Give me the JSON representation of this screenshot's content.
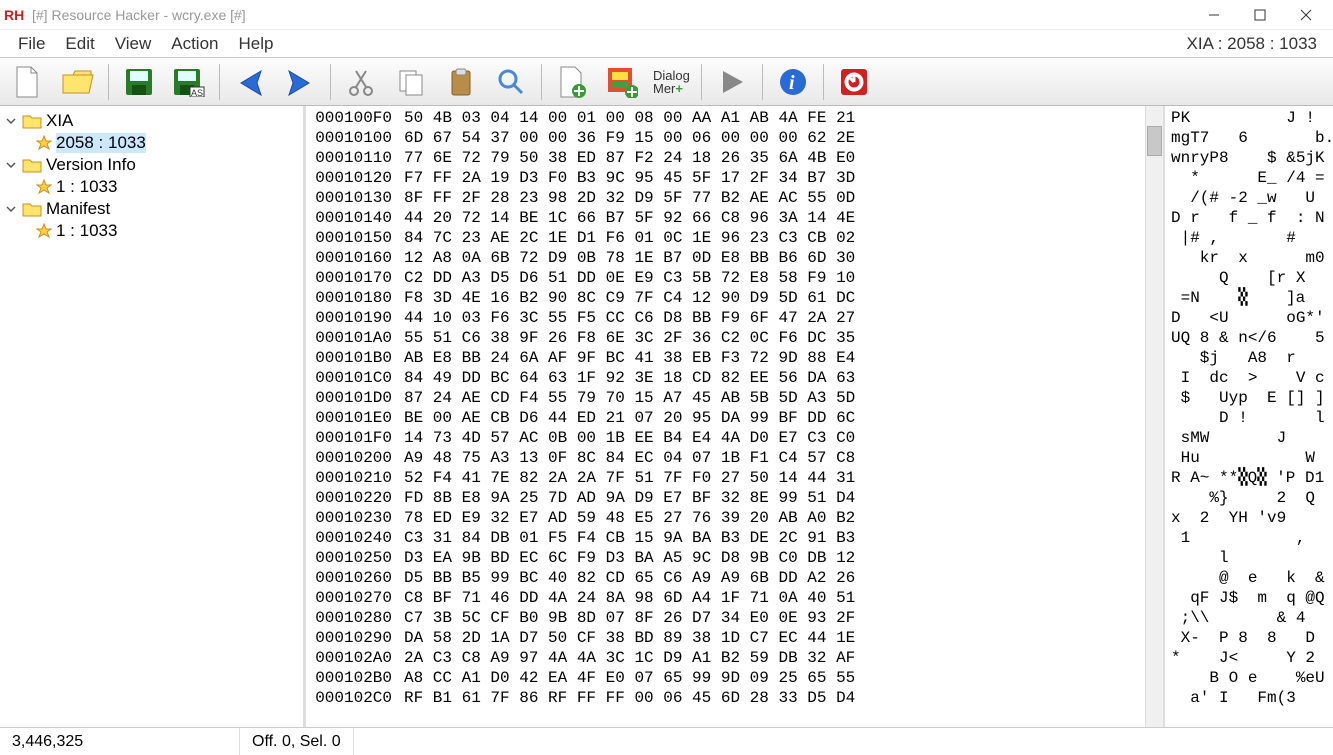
{
  "window": {
    "title": "[#] Resource Hacker - wcry.exe [#]",
    "icon_label": "RH",
    "breadcrumb": "XIA : 2058 : 1033"
  },
  "menu": {
    "items": [
      "File",
      "Edit",
      "View",
      "Action",
      "Help"
    ]
  },
  "toolbar": {
    "names": [
      "new-file",
      "open-file",
      "save",
      "save-as",
      "blue-back",
      "blue-forward",
      "cut",
      "copy",
      "paste",
      "find",
      "add-resource",
      "replace-resource",
      "dialog-tool",
      "play",
      "info",
      "stop"
    ],
    "dialog_label": "Dialog\nMer"
  },
  "tree": {
    "nodes": [
      {
        "label": "XIA",
        "expanded": true,
        "children": [
          {
            "label": "2058 : 1033",
            "selected": true
          }
        ]
      },
      {
        "label": "Version Info",
        "expanded": true,
        "children": [
          {
            "label": "1 : 1033"
          }
        ]
      },
      {
        "label": "Manifest",
        "expanded": true,
        "children": [
          {
            "label": "1 : 1033"
          }
        ]
      }
    ]
  },
  "hex": {
    "rows": [
      {
        "off": "000100F0",
        "b": "50 4B 03 04 14 00 01 00 08 00 AA A1 AB 4A FE 21",
        "a": "PK          J !"
      },
      {
        "off": "00010100",
        "b": "6D 67 54 37 00 00 36 F9 15 00 06 00 00 00 62 2E",
        "a": "mgT7   6       b."
      },
      {
        "off": "00010110",
        "b": "77 6E 72 79 50 38 ED 87 F2 24 18 26 35 6A 4B E0",
        "a": "wnryP8    $ &5jK"
      },
      {
        "off": "00010120",
        "b": "F7 FF 2A 19 D3 F0 B3 9C 95 45 5F 17 2F 34 B7 3D",
        "a": "  *      E_ /4 ="
      },
      {
        "off": "00010130",
        "b": "8F FF 2F 28 23 98 2D 32 D9 5F 77 B2 AE AC 55 0D",
        "a": "  /(# -2 _w   U"
      },
      {
        "off": "00010140",
        "b": "44 20 72 14 BE 1C 66 B7 5F 92 66 C8 96 3A 14 4E",
        "a": "D r   f _ f  : N"
      },
      {
        "off": "00010150",
        "b": "84 7C 23 AE 2C 1E D1 F6 01 0C 1E 96 23 C3 CB 02",
        "a": " |# ,       #"
      },
      {
        "off": "00010160",
        "b": "12 A8 0A 6B 72 D9 0B 78 1E B7 0D E8 BB B6 6D 30",
        "a": "   kr  x      m0"
      },
      {
        "off": "00010170",
        "b": "C2 DD A3 D5 D6 51 DD 0E E9 C3 5B 72 E8 58 F9 10",
        "a": "     Q    [r X"
      },
      {
        "off": "00010180",
        "b": "F8 3D 4E 16 B2 90 8C C9 7F C4 12 90 D9 5D 61 DC",
        "a": " =N    🮕    ]a"
      },
      {
        "off": "00010190",
        "b": "44 10 03 F6 3C 55 F5 CC C6 D8 BB F9 6F 47 2A 27",
        "a": "D   <U      oG*'"
      },
      {
        "off": "000101A0",
        "b": "55 51 C6 38 9F 26 F8 6E 3C 2F 36 C2 0C F6 DC 35",
        "a": "UQ 8 & n</6    5"
      },
      {
        "off": "000101B0",
        "b": "AB E8 BB 24 6A AF 9F BC 41 38 EB F3 72 9D 88 E4",
        "a": "   $j   A8  r"
      },
      {
        "off": "000101C0",
        "b": "84 49 DD BC 64 63 1F 92 3E 18 CD 82 EE 56 DA 63",
        "a": " I  dc  >    V c"
      },
      {
        "off": "000101D0",
        "b": "87 24 AE CD F4 55 79 70 15 A7 45 AB 5B 5D A3 5D",
        "a": " $   Uyp  E [] ]"
      },
      {
        "off": "000101E0",
        "b": "BE 00 AE CB D6 44 ED 21 07 20 95 DA 99 BF DD 6C",
        "a": "     D !       l"
      },
      {
        "off": "000101F0",
        "b": "14 73 4D 57 AC 0B 00 1B EE B4 E4 4A D0 E7 C3 C0",
        "a": " sMW       J"
      },
      {
        "off": "00010200",
        "b": "A9 48 75 A3 13 0F 8C 84 EC 04 07 1B F1 C4 57 C8",
        "a": " Hu           W"
      },
      {
        "off": "00010210",
        "b": "52 F4 41 7E 82 2A 2A 7F 51 7F F0 27 50 14 44 31",
        "a": "R A~ **🮕Q🮕 'P D1"
      },
      {
        "off": "00010220",
        "b": "FD 8B E8 9A 25 7D AD 9A D9 E7 BF 32 8E 99 51 D4",
        "a": "    %}     2  Q"
      },
      {
        "off": "00010230",
        "b": "78 ED E9 32 E7 AD 59 48 E5 27 76 39 20 AB A0 B2",
        "a": "x  2  YH 'v9"
      },
      {
        "off": "00010240",
        "b": "C3 31 84 DB 01 F5 F4 CB 15 9A BA B3 DE 2C 91 B3",
        "a": " 1           ,"
      },
      {
        "off": "00010250",
        "b": "D3 EA 9B BD EC 6C F9 D3 BA A5 9C D8 9B C0 DB 12",
        "a": "     l"
      },
      {
        "off": "00010260",
        "b": "D5 BB B5 99 BC 40 82 CD 65 C6 A9 A9 6B DD A2 26",
        "a": "     @  e   k  &"
      },
      {
        "off": "00010270",
        "b": "C8 BF 71 46 DD 4A 24 8A 98 6D A4 1F 71 0A 40 51",
        "a": "  qF J$  m  q @Q"
      },
      {
        "off": "00010280",
        "b": "C7 3B 5C CF B0 9B 8D 07 8F 26 D7 34 E0 0E 93 2F",
        "a": " ;\\\\       & 4   /"
      },
      {
        "off": "00010290",
        "b": "DA 58 2D 1A D7 50 CF 38 BD 89 38 1D C7 EC 44 1E",
        "a": " X-  P 8  8   D"
      },
      {
        "off": "000102A0",
        "b": "2A C3 C8 A9 97 4A 4A 3C 1C D9 A1 B2 59 DB 32 AF",
        "a": "*    J<     Y 2"
      },
      {
        "off": "000102B0",
        "b": "A8 CC A1 D0 42 EA 4F E0 07 65 99 9D 09 25 65 55",
        "a": "    B O e    %eU"
      },
      {
        "off": "000102C0",
        "b": "RF B1 61 7F 86 RF FF FF 00 06 45 6D 28 33 D5 D4",
        "a": "  a' I   Fm(3"
      }
    ]
  },
  "status": {
    "pos": "3,446,325",
    "sel": "Off. 0, Sel. 0"
  }
}
